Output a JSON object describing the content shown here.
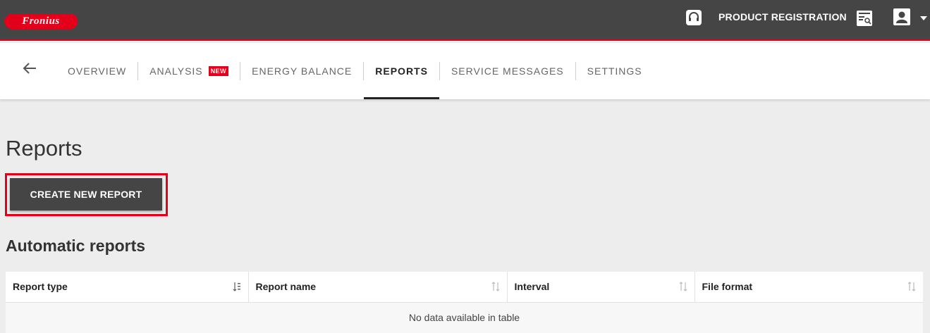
{
  "header": {
    "logo_text": "Fronius",
    "product_registration": "PRODUCT REGISTRATION",
    "icons": [
      "headset-icon",
      "registration-icon",
      "user-icon",
      "caret-down-icon"
    ]
  },
  "nav": {
    "tabs": [
      {
        "label": "OVERVIEW"
      },
      {
        "label": "ANALYSIS",
        "badge": "NEW"
      },
      {
        "label": "ENERGY BALANCE"
      },
      {
        "label": "REPORTS",
        "active": true
      },
      {
        "label": "SERVICE MESSAGES"
      },
      {
        "label": "SETTINGS"
      }
    ]
  },
  "main": {
    "title": "Reports",
    "create_button": "CREATE NEW REPORT",
    "section_title": "Automatic reports",
    "table": {
      "columns": [
        "Report type",
        "Report name",
        "Interval",
        "File format"
      ],
      "empty_message": "No data available in table"
    }
  },
  "colors": {
    "brand_red": "#e2001a",
    "header_bg": "#454545",
    "page_bg": "#ecedec"
  }
}
